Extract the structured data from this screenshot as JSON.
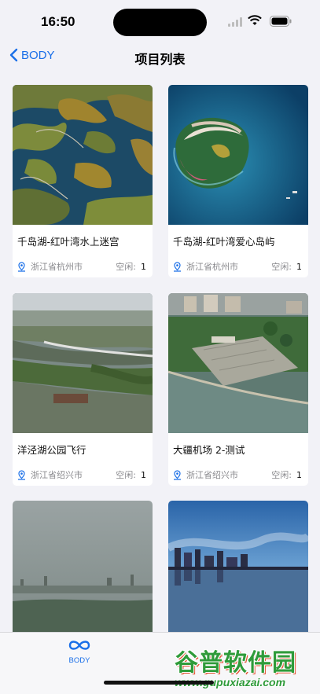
{
  "status_bar": {
    "time": "16:50"
  },
  "nav": {
    "back_label": "BODY",
    "title": "项目列表"
  },
  "projects": [
    {
      "name": "千岛湖-红叶湾水上迷宫",
      "location": "浙江省杭州市",
      "idle_label": "空闲:",
      "idle_count": "1"
    },
    {
      "name": "千岛湖-红叶湾爱心岛屿",
      "location": "浙江省杭州市",
      "idle_label": "空闲:",
      "idle_count": "1"
    },
    {
      "name": "洋泾湖公园飞行",
      "location": "浙江省绍兴市",
      "idle_label": "空闲:",
      "idle_count": "1"
    },
    {
      "name": "大疆机场 2-测试",
      "location": "浙江省绍兴市",
      "idle_label": "空闲:",
      "idle_count": "1"
    }
  ],
  "tab_bar": {
    "items": [
      {
        "label": "BODY",
        "icon": "infinity-icon",
        "selected": true
      }
    ]
  },
  "watermark": {
    "logo": "谷普软件园",
    "url": "www.gupuxiazai.com"
  },
  "colors": {
    "accent": "#1a6fe8",
    "background": "#f2f2f7",
    "card": "#ffffff",
    "muted_text": "#8a8a8e"
  }
}
